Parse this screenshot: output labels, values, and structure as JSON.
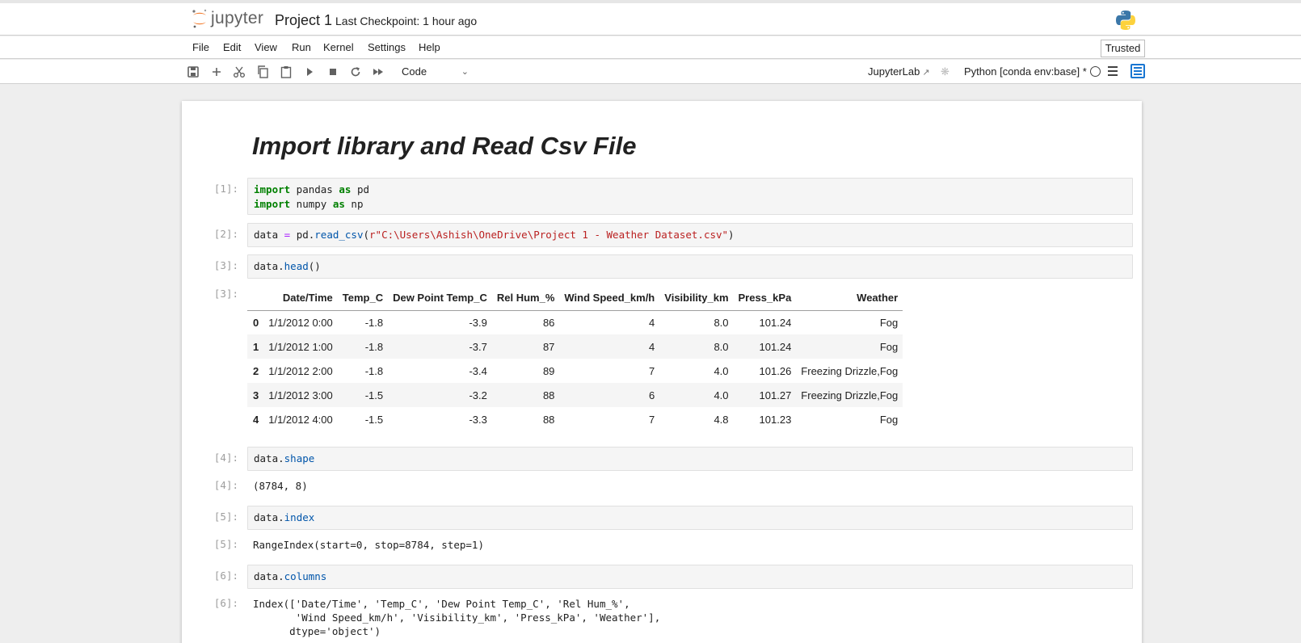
{
  "header": {
    "logo_text": "jupyter",
    "notebook_title": "Project 1",
    "checkpoint": "Last Checkpoint: 1 hour ago"
  },
  "menubar": {
    "items": [
      "File",
      "Edit",
      "View",
      "Run",
      "Kernel",
      "Settings",
      "Help"
    ],
    "trusted": "Trusted"
  },
  "toolbar": {
    "icons": [
      "save-icon",
      "add-icon",
      "cut-icon",
      "copy-icon",
      "paste-icon",
      "run-icon",
      "stop-icon",
      "restart-icon",
      "fast-forward-icon"
    ],
    "cell_type": "Code",
    "jupyterlab_link": "JupyterLab",
    "kernel_name": "Python [conda env:base] *"
  },
  "notebook": {
    "heading": "Import library and Read Csv File",
    "cells": [
      {
        "prompt": "[1]:",
        "code_lines": [
          [
            "import",
            " pandas ",
            "as",
            " pd"
          ],
          [
            "import",
            " numpy ",
            "as",
            " np"
          ]
        ]
      },
      {
        "prompt": "[2]:",
        "code": {
          "var": "data ",
          "eq": "=",
          "mid": " pd.",
          "fn": "read_csv",
          "open": "(",
          "str": "r\"C:\\Users\\Ashish\\OneDrive\\Project 1 - Weather Dataset.csv\"",
          "close": ")"
        }
      },
      {
        "prompt": "[3]:",
        "code": {
          "obj": "data.",
          "attr": "head",
          "rest": "()"
        },
        "out_prompt": "[3]:"
      },
      {
        "prompt": "[4]:",
        "code": {
          "obj": "data.",
          "attr": "shape"
        },
        "out_prompt": "[4]:",
        "output": "(8784, 8)"
      },
      {
        "prompt": "[5]:",
        "code": {
          "obj": "data.",
          "attr": "index"
        },
        "out_prompt": "[5]:",
        "output": "RangeIndex(start=0, stop=8784, step=1)"
      },
      {
        "prompt": "[6]:",
        "code": {
          "obj": "data.",
          "attr": "columns"
        },
        "out_prompt": "[6]:",
        "output": "Index(['Date/Time', 'Temp_C', 'Dew Point Temp_C', 'Rel Hum_%',\n       'Wind Speed_km/h', 'Visibility_km', 'Press_kPa', 'Weather'],\n      dtype='object')"
      }
    ],
    "dataframe": {
      "columns": [
        "",
        "Date/Time",
        "Temp_C",
        "Dew Point Temp_C",
        "Rel Hum_%",
        "Wind Speed_km/h",
        "Visibility_km",
        "Press_kPa",
        "Weather"
      ],
      "rows": [
        [
          "0",
          "1/1/2012 0:00",
          "-1.8",
          "-3.9",
          "86",
          "4",
          "8.0",
          "101.24",
          "Fog"
        ],
        [
          "1",
          "1/1/2012 1:00",
          "-1.8",
          "-3.7",
          "87",
          "4",
          "8.0",
          "101.24",
          "Fog"
        ],
        [
          "2",
          "1/1/2012 2:00",
          "-1.8",
          "-3.4",
          "89",
          "7",
          "4.0",
          "101.26",
          "Freezing Drizzle,Fog"
        ],
        [
          "3",
          "1/1/2012 3:00",
          "-1.5",
          "-3.2",
          "88",
          "6",
          "4.0",
          "101.27",
          "Freezing Drizzle,Fog"
        ],
        [
          "4",
          "1/1/2012 4:00",
          "-1.5",
          "-3.3",
          "88",
          "7",
          "4.8",
          "101.23",
          "Fog"
        ]
      ]
    }
  },
  "colors": {
    "accent": "#f37726",
    "keyword": "#008000",
    "string": "#ba2121",
    "attribute": "#0055aa"
  }
}
